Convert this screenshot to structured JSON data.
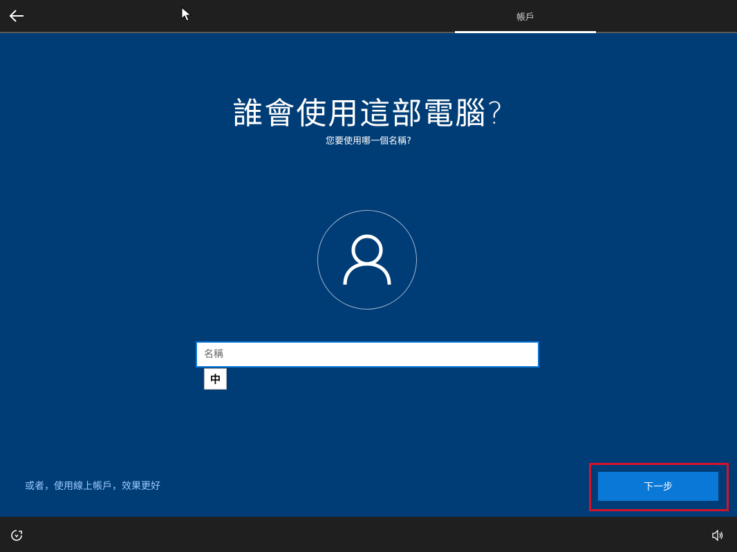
{
  "topbar": {
    "back_icon": "arrow-left-icon",
    "tab_label": "帳戶"
  },
  "main": {
    "title": "誰會使用這部電腦?",
    "subtitle": "您要使用哪一個名稱?",
    "avatar_icon": "user-icon",
    "name_field": {
      "placeholder": "名稱",
      "value": ""
    },
    "ime_indicator": "中",
    "online_account_link": "或者，使用線上帳戶，效果更好",
    "next_button": "下一步"
  },
  "bottombar": {
    "accessibility_icon": "ease-of-access-icon",
    "volume_icon": "volume-icon"
  },
  "colors": {
    "background": "#003d76",
    "bar": "#1f1f1f",
    "accent": "#0a78d7",
    "highlight": "#d9112a",
    "link": "#9cc9ff"
  }
}
